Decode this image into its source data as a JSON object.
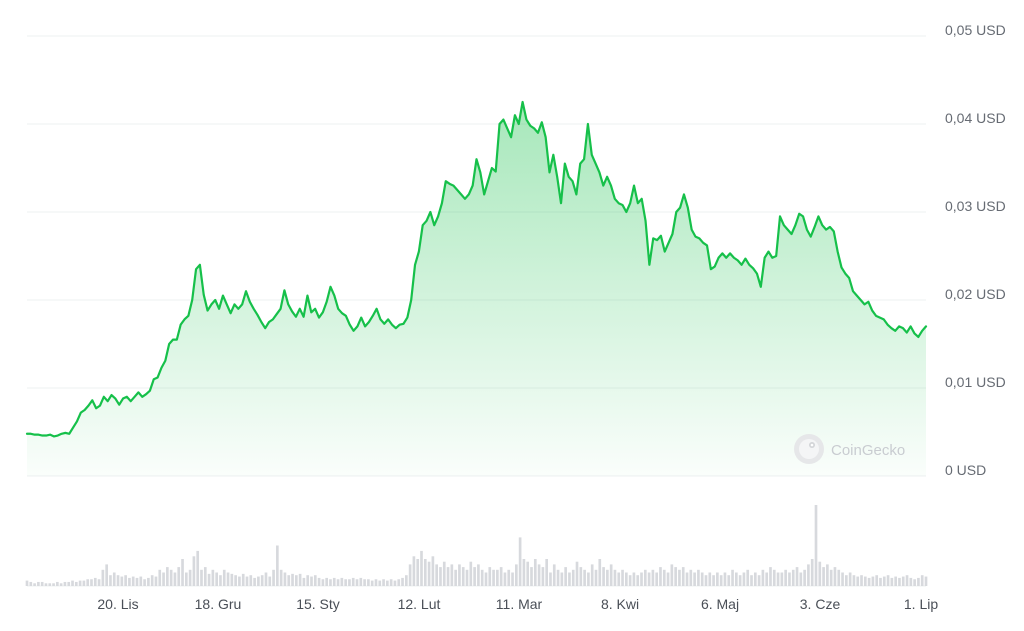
{
  "chart_data": {
    "type": "area",
    "y_unit_suffix": " USD",
    "y_ticks": [
      {
        "value": 0,
        "label": "0 USD"
      },
      {
        "value": 0.01,
        "label": "0,01 USD"
      },
      {
        "value": 0.02,
        "label": "0,02 USD"
      },
      {
        "value": 0.03,
        "label": "0,03 USD"
      },
      {
        "value": 0.04,
        "label": "0,04 USD"
      },
      {
        "value": 0.05,
        "label": "0,05 USD"
      }
    ],
    "ylim": [
      0,
      0.05
    ],
    "x_ticks": [
      "20. Lis",
      "18. Gru",
      "15. Sty",
      "12. Lut",
      "11. Mar",
      "8. Kwi",
      "6. Maj",
      "3. Cze",
      "1. Lip"
    ],
    "grid": true,
    "line_color": "#16c04a",
    "series": [
      {
        "values": [
          0.0048,
          0.0048,
          0.0047,
          0.0047,
          0.0046,
          0.0046,
          0.0047,
          0.0045,
          0.0046,
          0.0048,
          0.0049,
          0.0048,
          0.0055,
          0.0062,
          0.0072,
          0.0075,
          0.008,
          0.0086,
          0.0077,
          0.008,
          0.009,
          0.0085,
          0.0092,
          0.0088,
          0.0081,
          0.0088,
          0.009,
          0.0085,
          0.009,
          0.0095,
          0.009,
          0.0093,
          0.0097,
          0.011,
          0.0112,
          0.0123,
          0.0131,
          0.015,
          0.0155,
          0.0155,
          0.0172,
          0.0178,
          0.0182,
          0.02,
          0.0235,
          0.024,
          0.0206,
          0.0188,
          0.0195,
          0.02,
          0.019,
          0.0205,
          0.0195,
          0.0185,
          0.0195,
          0.019,
          0.0195,
          0.021,
          0.0198,
          0.019,
          0.0183,
          0.0175,
          0.0168,
          0.0175,
          0.0178,
          0.0184,
          0.019,
          0.0211,
          0.0195,
          0.0187,
          0.0181,
          0.019,
          0.0181,
          0.0205,
          0.0186,
          0.019,
          0.018,
          0.0186,
          0.0198,
          0.0215,
          0.0205,
          0.019,
          0.0185,
          0.0182,
          0.0172,
          0.0165,
          0.017,
          0.018,
          0.017,
          0.0175,
          0.0182,
          0.019,
          0.0178,
          0.0173,
          0.0178,
          0.0172,
          0.0168,
          0.0172,
          0.0173,
          0.018,
          0.02,
          0.024,
          0.0255,
          0.0285,
          0.029,
          0.03,
          0.0285,
          0.0295,
          0.031,
          0.0335,
          0.0332,
          0.033,
          0.0325,
          0.032,
          0.0315,
          0.032,
          0.033,
          0.036,
          0.0345,
          0.032,
          0.0335,
          0.035,
          0.0346,
          0.04,
          0.0405,
          0.0395,
          0.0385,
          0.041,
          0.04,
          0.0425,
          0.0405,
          0.0398,
          0.0395,
          0.039,
          0.0402,
          0.0385,
          0.0345,
          0.0365,
          0.034,
          0.031,
          0.0355,
          0.034,
          0.0335,
          0.032,
          0.0355,
          0.036,
          0.04,
          0.0365,
          0.0355,
          0.0345,
          0.033,
          0.034,
          0.033,
          0.0315,
          0.031,
          0.0308,
          0.03,
          0.031,
          0.033,
          0.031,
          0.0315,
          0.029,
          0.024,
          0.027,
          0.0268,
          0.0273,
          0.0255,
          0.0265,
          0.0275,
          0.03,
          0.0305,
          0.032,
          0.0305,
          0.028,
          0.0272,
          0.027,
          0.0265,
          0.0262,
          0.0235,
          0.0238,
          0.0248,
          0.0253,
          0.0248,
          0.0253,
          0.0248,
          0.0245,
          0.024,
          0.0247,
          0.024,
          0.0236,
          0.023,
          0.0215,
          0.0248,
          0.0255,
          0.0248,
          0.025,
          0.0295,
          0.0285,
          0.028,
          0.0275,
          0.0285,
          0.0298,
          0.0295,
          0.028,
          0.0272,
          0.0283,
          0.0295,
          0.0285,
          0.028,
          0.0283,
          0.0278,
          0.0255,
          0.0237,
          0.023,
          0.0225,
          0.021,
          0.0205,
          0.02,
          0.0195,
          0.0198,
          0.0188,
          0.0182,
          0.018,
          0.0178,
          0.0172,
          0.0168,
          0.0165,
          0.017,
          0.0168,
          0.0163,
          0.017,
          0.0162,
          0.0158,
          0.0165,
          0.017
        ]
      }
    ],
    "volume_values": [
      0.04,
      0.03,
      0.02,
      0.03,
      0.03,
      0.02,
      0.02,
      0.02,
      0.03,
      0.02,
      0.03,
      0.03,
      0.04,
      0.03,
      0.04,
      0.04,
      0.05,
      0.05,
      0.06,
      0.05,
      0.12,
      0.16,
      0.08,
      0.1,
      0.08,
      0.07,
      0.08,
      0.06,
      0.07,
      0.06,
      0.07,
      0.05,
      0.06,
      0.08,
      0.07,
      0.12,
      0.1,
      0.14,
      0.12,
      0.1,
      0.14,
      0.2,
      0.1,
      0.12,
      0.22,
      0.26,
      0.12,
      0.14,
      0.09,
      0.12,
      0.1,
      0.08,
      0.12,
      0.1,
      0.09,
      0.08,
      0.07,
      0.09,
      0.07,
      0.08,
      0.06,
      0.07,
      0.08,
      0.1,
      0.07,
      0.12,
      0.3,
      0.12,
      0.1,
      0.08,
      0.09,
      0.08,
      0.09,
      0.06,
      0.08,
      0.07,
      0.08,
      0.06,
      0.05,
      0.06,
      0.05,
      0.06,
      0.05,
      0.06,
      0.05,
      0.05,
      0.06,
      0.05,
      0.06,
      0.05,
      0.05,
      0.04,
      0.05,
      0.04,
      0.05,
      0.04,
      0.05,
      0.04,
      0.05,
      0.06,
      0.08,
      0.16,
      0.22,
      0.2,
      0.26,
      0.2,
      0.18,
      0.22,
      0.16,
      0.14,
      0.18,
      0.14,
      0.16,
      0.12,
      0.16,
      0.14,
      0.12,
      0.18,
      0.14,
      0.16,
      0.12,
      0.1,
      0.14,
      0.12,
      0.12,
      0.14,
      0.1,
      0.12,
      0.1,
      0.16,
      0.36,
      0.2,
      0.18,
      0.14,
      0.2,
      0.16,
      0.14,
      0.2,
      0.1,
      0.16,
      0.12,
      0.1,
      0.14,
      0.1,
      0.12,
      0.18,
      0.14,
      0.12,
      0.1,
      0.16,
      0.12,
      0.2,
      0.14,
      0.12,
      0.16,
      0.12,
      0.1,
      0.12,
      0.1,
      0.08,
      0.1,
      0.08,
      0.1,
      0.12,
      0.1,
      0.12,
      0.1,
      0.14,
      0.12,
      0.1,
      0.16,
      0.14,
      0.12,
      0.14,
      0.1,
      0.12,
      0.1,
      0.12,
      0.1,
      0.08,
      0.1,
      0.08,
      0.1,
      0.08,
      0.1,
      0.08,
      0.12,
      0.1,
      0.08,
      0.1,
      0.12,
      0.08,
      0.1,
      0.08,
      0.12,
      0.1,
      0.14,
      0.12,
      0.1,
      0.1,
      0.12,
      0.1,
      0.12,
      0.14,
      0.1,
      0.12,
      0.16,
      0.2,
      0.6,
      0.18,
      0.14,
      0.16,
      0.12,
      0.14,
      0.12,
      0.1,
      0.08,
      0.1,
      0.08,
      0.07,
      0.08,
      0.07,
      0.06,
      0.07,
      0.08,
      0.06,
      0.07,
      0.08,
      0.06,
      0.07,
      0.06,
      0.07,
      0.08,
      0.06,
      0.05,
      0.06,
      0.08,
      0.07
    ]
  },
  "watermark": {
    "text": "CoinGecko",
    "icon": "gecko-logo-icon"
  }
}
